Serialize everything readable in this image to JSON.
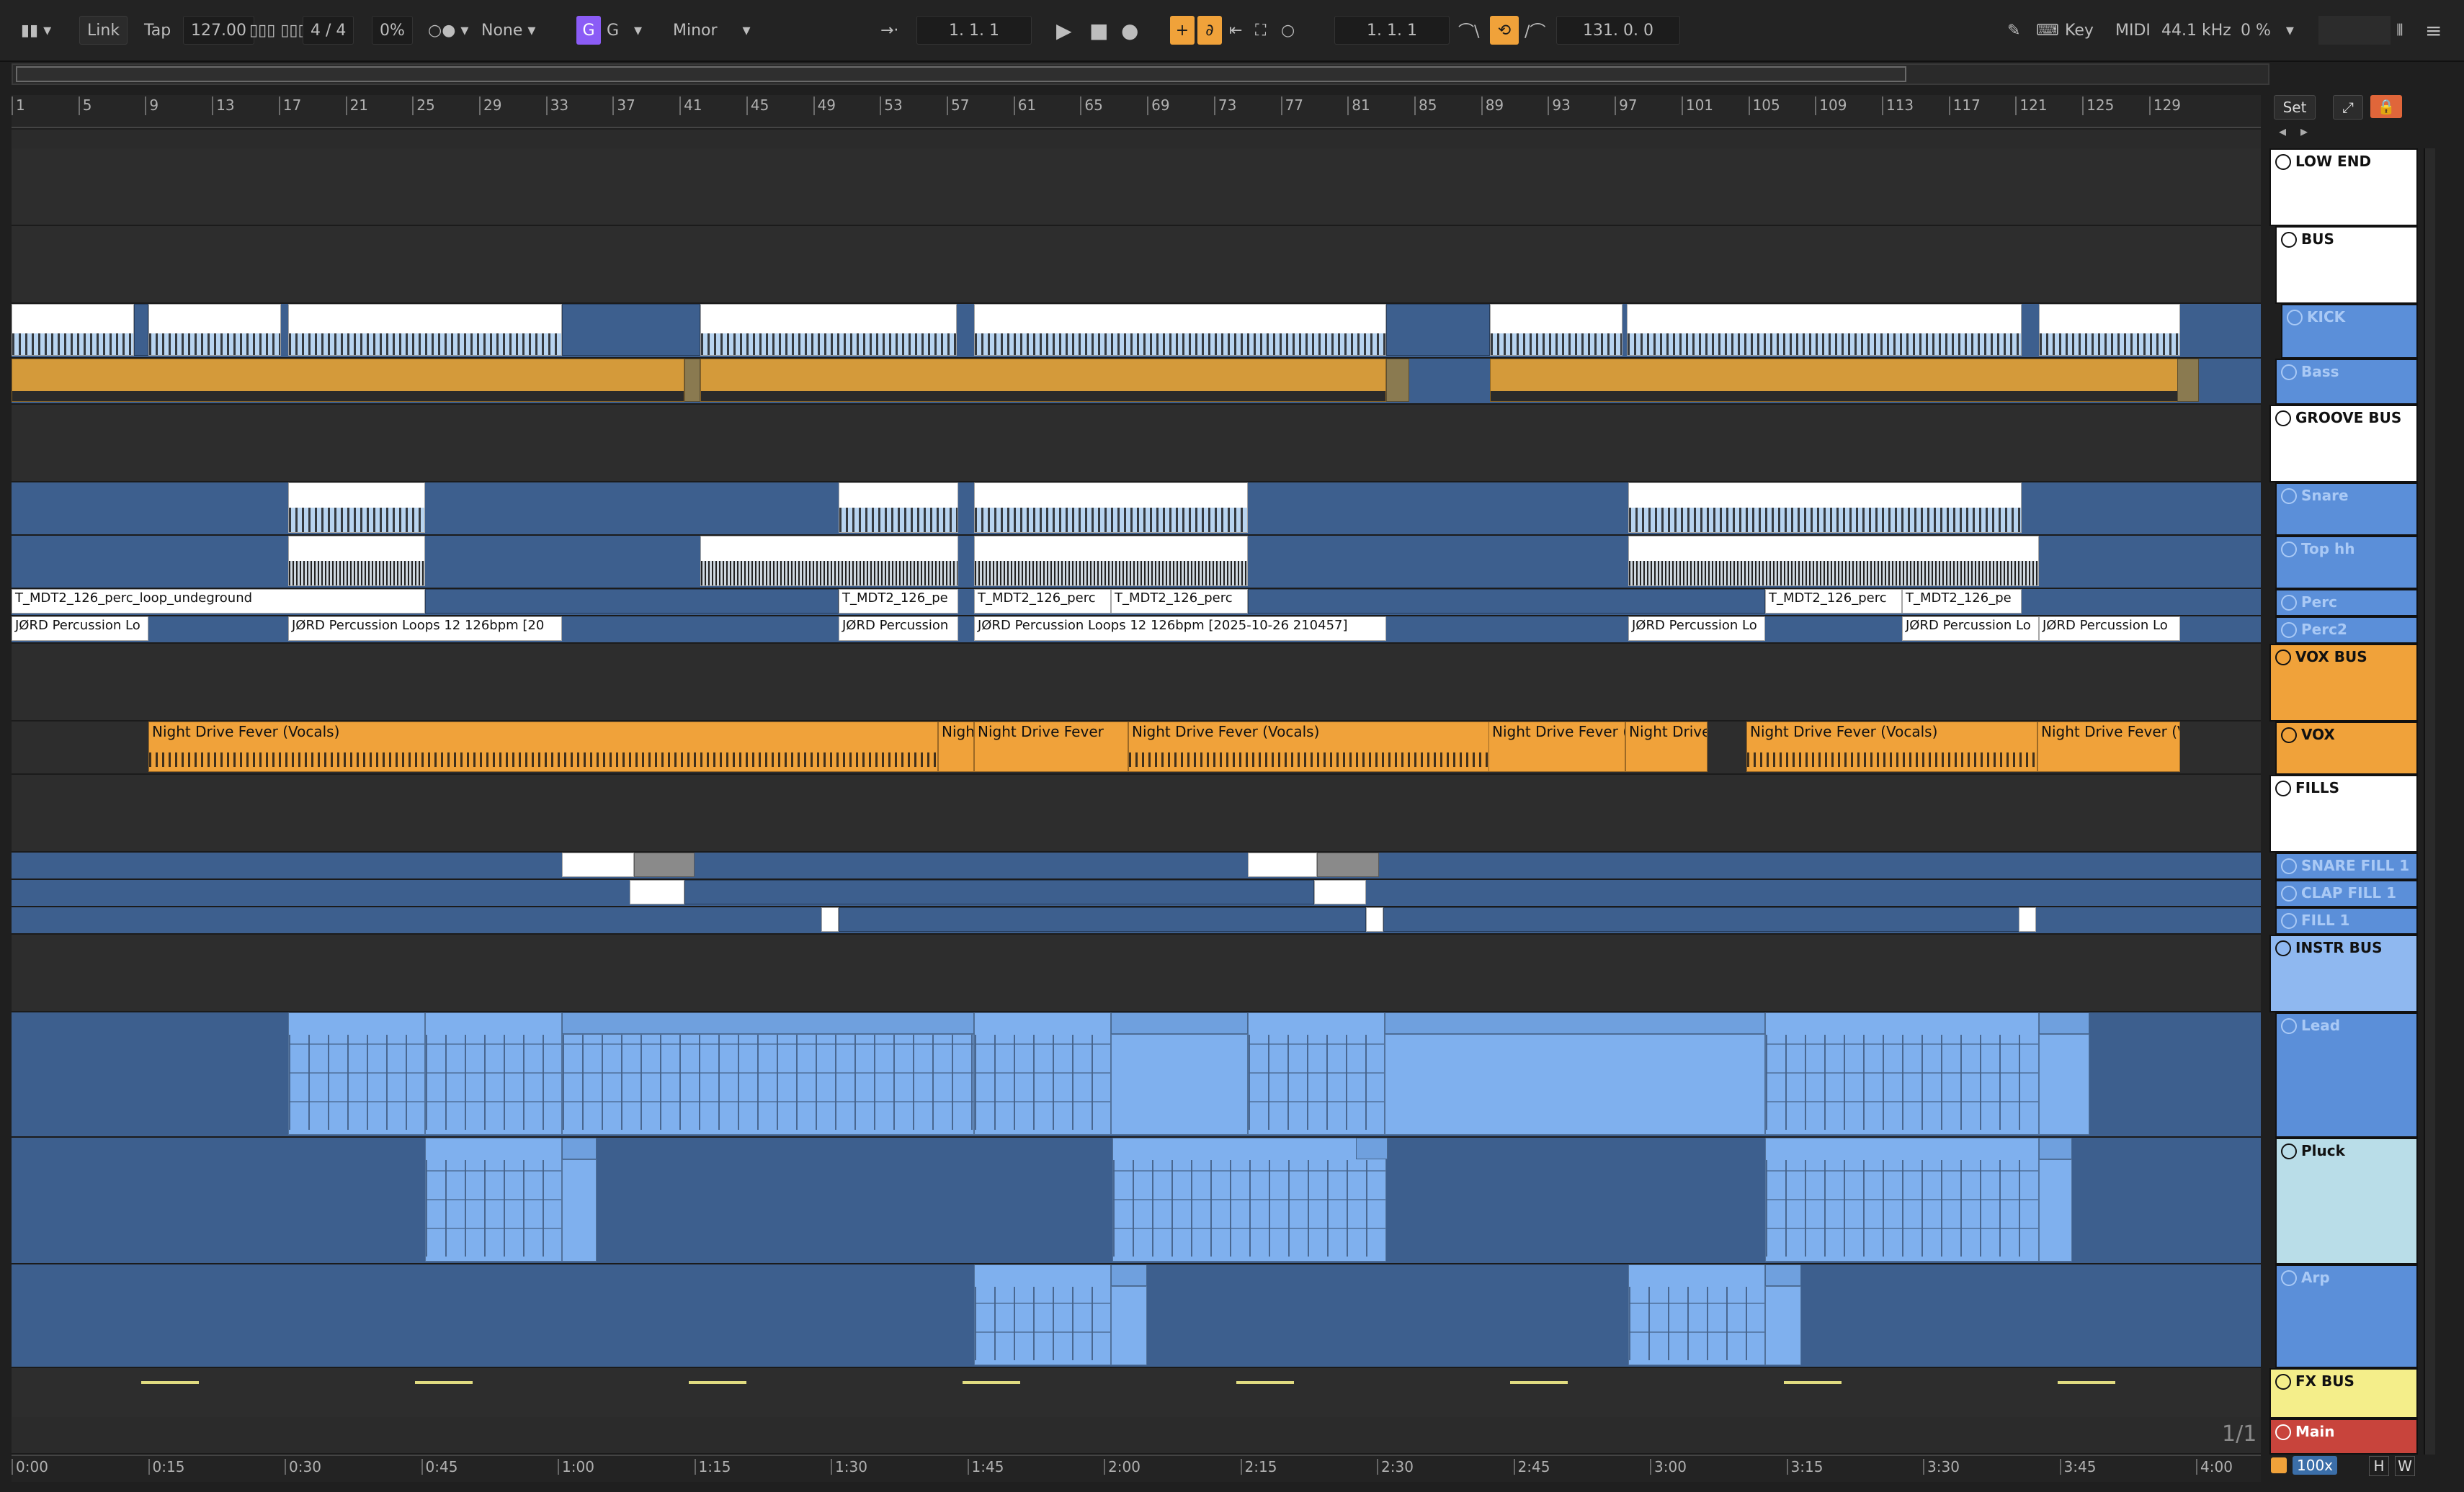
{
  "transport": {
    "link": "Link",
    "tap": "Tap",
    "tempo": "127.00",
    "time_signature": "4 / 4",
    "swing": "0%",
    "quantize": "None",
    "key": "G",
    "scale": "Minor",
    "arrangement_position": "1.  1.  1",
    "loop_start": "1.  1.  1",
    "loop_length": "131.  0.  0",
    "key_map": "Key",
    "midi_map": "MIDI",
    "sample_rate": "44.1 kHz",
    "cpu": "0 %"
  },
  "ruler": {
    "bars": [
      "1",
      "5",
      "9",
      "13",
      "17",
      "21",
      "25",
      "29",
      "33",
      "37",
      "41",
      "45",
      "49",
      "53",
      "57",
      "61",
      "65",
      "69",
      "73",
      "77",
      "81",
      "85",
      "89",
      "93",
      "97",
      "101",
      "105",
      "109",
      "113",
      "117",
      "121",
      "125",
      "129"
    ],
    "set_label": "Set"
  },
  "timebar": {
    "times": [
      "0:00",
      "0:15",
      "0:30",
      "0:45",
      "1:00",
      "1:15",
      "1:30",
      "1:45",
      "2:00",
      "2:15",
      "2:30",
      "2:45",
      "3:00",
      "3:15",
      "3:30",
      "3:45",
      "4:00"
    ],
    "page_indicator": "1/1",
    "zoom": "100x",
    "h": "H",
    "w": "W"
  },
  "tracks": [
    {
      "name": "LOW END",
      "color": "#ffffff",
      "text": "#111111"
    },
    {
      "name": "BUS",
      "color": "#ffffff",
      "text": "#111111"
    },
    {
      "name": "KICK",
      "color": "#5b8fd9",
      "text": "#a9c9f5"
    },
    {
      "name": "Bass",
      "color": "#5b8fd9",
      "text": "#a9c9f5"
    },
    {
      "name": "GROOVE BUS",
      "color": "#ffffff",
      "text": "#111111"
    },
    {
      "name": "Snare",
      "color": "#5b8fd9",
      "text": "#a9c9f5"
    },
    {
      "name": "Top hh",
      "color": "#5b8fd9",
      "text": "#a9c9f5"
    },
    {
      "name": "Perc",
      "color": "#5b8fd9",
      "text": "#a9c9f5"
    },
    {
      "name": "Perc2",
      "color": "#5b8fd9",
      "text": "#a9c9f5"
    },
    {
      "name": "VOX BUS",
      "color": "#f0a23a",
      "text": "#111111"
    },
    {
      "name": "VOX",
      "color": "#f0a23a",
      "text": "#111111"
    },
    {
      "name": "FILLS",
      "color": "#ffffff",
      "text": "#111111"
    },
    {
      "name": "SNARE FILL 1",
      "color": "#5b8fd9",
      "text": "#a9c9f5"
    },
    {
      "name": "CLAP FILL 1",
      "color": "#5b8fd9",
      "text": "#a9c9f5"
    },
    {
      "name": "FILL 1",
      "color": "#5b8fd9",
      "text": "#a9c9f5"
    },
    {
      "name": "INSTR BUS",
      "color": "#8fb8f0",
      "text": "#111111"
    },
    {
      "name": "Lead",
      "color": "#5b8fd9",
      "text": "#a9c9f5"
    },
    {
      "name": "Pluck",
      "color": "#b9dde8",
      "text": "#111111"
    },
    {
      "name": "Arp",
      "color": "#5b8fd9",
      "text": "#a9c9f5"
    },
    {
      "name": "FX BUS",
      "color": "#f4ee8a",
      "text": "#111111"
    },
    {
      "name": "Main",
      "color": "#c8443c",
      "text": "#ffffff"
    }
  ],
  "clips": {
    "perc_1": "T_MDT2_126_perc_loop_undeground",
    "perc_2": "T_MDT2_126_pe",
    "perc_3": "T_MDT2_126_perc",
    "perc_4": "T_MDT2_126_perc",
    "perc_5": "T_MDT2_126_perc",
    "perc_6": "T_MDT2_126_pe",
    "perc2_1": "JØRD Percussion Lo",
    "perc2_2": "JØRD Percussion Loops 12 126bpm [20",
    "perc2_3": "JØRD Percussion",
    "perc2_4": "JØRD Percussion Loops 12 126bpm [2025-10-26 210457]",
    "perc2_5": "JØRD Percussion Lo",
    "perc2_6": "JØRD Percussion Lo",
    "perc2_7": "JØRD Percussion Lo",
    "vox_1": "Night Drive Fever (Vocals)",
    "vox_2": "Nigh",
    "vox_3": "Night Drive Fever",
    "vox_4": "Night Drive Fever (Vocals)",
    "vox_5": "Night Drive Fever (",
    "vox_6": "Night Drive",
    "vox_7": "Night Drive Fever (Vocals)",
    "vox_8": "Night Drive Fever (V"
  }
}
